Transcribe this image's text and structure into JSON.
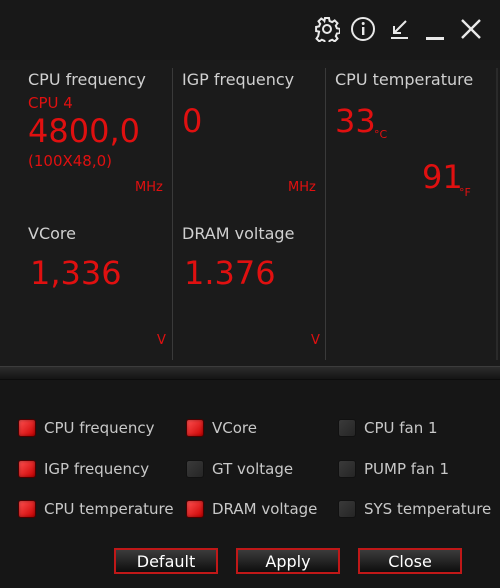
{
  "titlebar": {
    "icons": [
      "gear-icon",
      "info-icon",
      "minimize-to-corner-icon",
      "minimize-icon",
      "close-icon"
    ]
  },
  "colors": {
    "accent": "#e01010",
    "label": "#d0d0d0",
    "background": "#161616"
  },
  "metrics": {
    "cpu_freq": {
      "label": "CPU frequency",
      "core": "CPU 4",
      "value": "4800,0",
      "detail": "(100X48,0)",
      "unit": "MHz"
    },
    "igp_freq": {
      "label": "IGP frequency",
      "value": "0",
      "unit": "MHz"
    },
    "cpu_temp": {
      "label": "CPU temperature",
      "celsius": "33",
      "celsius_unit": "°C",
      "fahrenheit": "91",
      "fahrenheit_unit": "°F"
    },
    "vcore": {
      "label": "VCore",
      "value": "1,336",
      "unit": "V"
    },
    "dram_voltage": {
      "label": "DRAM voltage",
      "value": "1.376",
      "unit": "V"
    }
  },
  "options": [
    {
      "label": "CPU frequency",
      "checked": true
    },
    {
      "label": "IGP frequency",
      "checked": true
    },
    {
      "label": "CPU temperature",
      "checked": true
    },
    {
      "label": "VCore",
      "checked": true
    },
    {
      "label": "GT voltage",
      "checked": false
    },
    {
      "label": "DRAM voltage",
      "checked": true
    },
    {
      "label": "CPU fan 1",
      "checked": false
    },
    {
      "label": "PUMP fan 1",
      "checked": false
    },
    {
      "label": "SYS temperature",
      "checked": false
    }
  ],
  "buttons": {
    "default": "Default",
    "apply": "Apply",
    "close": "Close"
  }
}
